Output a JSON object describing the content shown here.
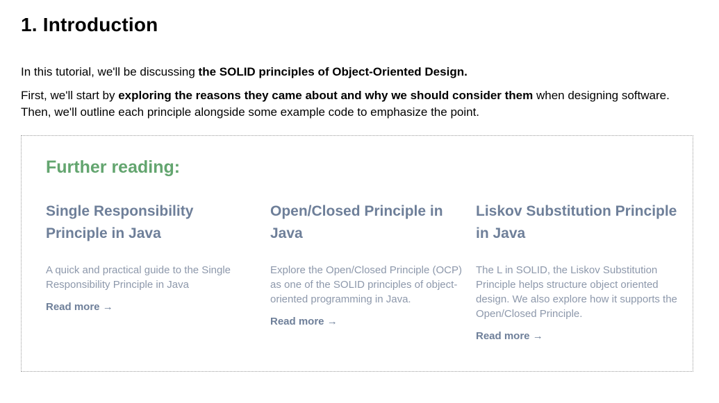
{
  "article": {
    "heading": "1. Introduction",
    "intro": {
      "text_before": "In this tutorial, we'll be discussing ",
      "bold": "the SOLID principles of Object-Oriented Design."
    },
    "overview": {
      "text_before": "First, we'll start by ",
      "bold": "exploring the reasons they came about and why we should consider them",
      "text_after": " when designing software. Then, we'll outline each principle alongside some example code to emphasize the point."
    }
  },
  "further_reading": {
    "title": "Further reading:",
    "cards": [
      {
        "title": "Single Responsibility Principle in Java",
        "description": "A quick and practical guide to the Single Responsibility Principle in Java",
        "link_label": "Read more →"
      },
      {
        "title": "Open/Closed Principle in Java",
        "description": "Explore the Open/Closed Principle (OCP) as one of the SOLID principles of object-oriented programming in Java.",
        "link_label": "Read more →"
      },
      {
        "title": "Liskov Substitution Principle in Java",
        "description": "The L in SOLID, the Liskov Substitution Principle helps structure object oriented design. We also explore how it supports the Open/Closed Principle.",
        "link_label": "Read more →"
      }
    ]
  },
  "colors": {
    "heading_text": "#000000",
    "further_title": "#63a56f",
    "card_title": "#6e7f99",
    "card_description": "#8d98ab",
    "box_border": "#9a9a9a"
  }
}
